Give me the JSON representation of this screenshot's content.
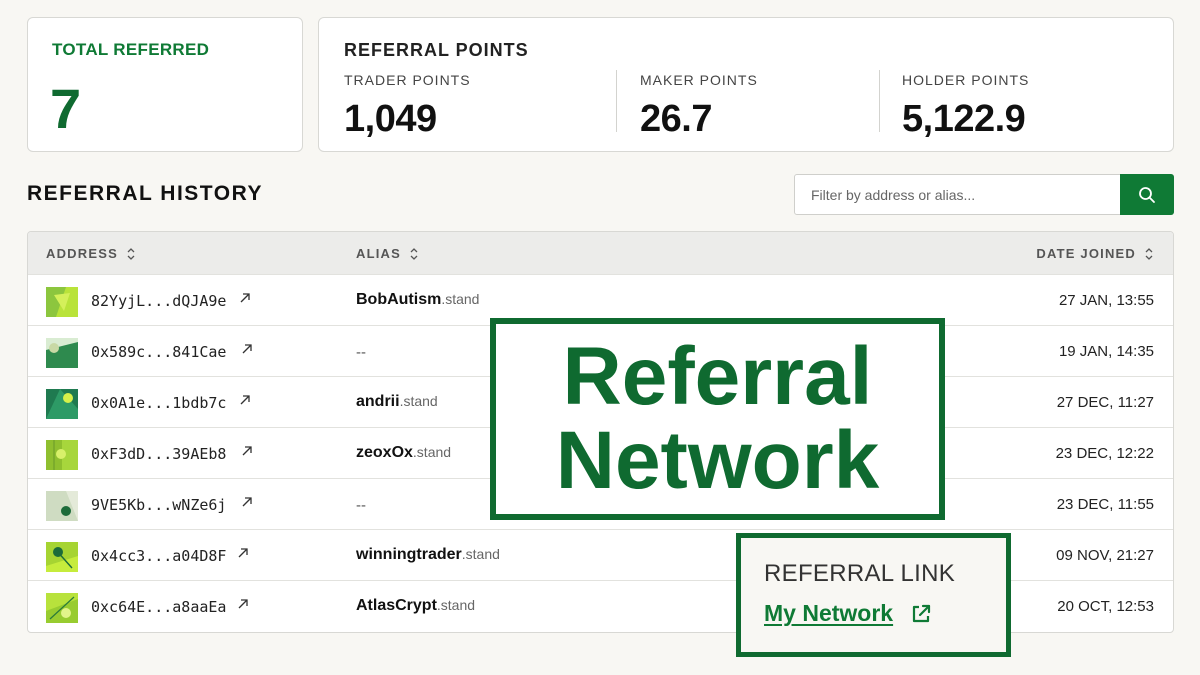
{
  "summary": {
    "total_label": "TOTAL REFERRED",
    "total_value": "7",
    "points_title": "REFERRAL POINTS",
    "points": [
      {
        "label": "TRADER POINTS",
        "value": "1,049"
      },
      {
        "label": "MAKER POINTS",
        "value": "26.7"
      },
      {
        "label": "HOLDER POINTS",
        "value": "5,122.9"
      }
    ]
  },
  "history": {
    "title": "REFERRAL HISTORY",
    "search_placeholder": "Filter by address or alias...",
    "columns": {
      "address": "ADDRESS",
      "alias": "ALIAS",
      "date": "DATE JOINED"
    },
    "rows": [
      {
        "address": "82YyjL...dQJA9e",
        "alias": "BobAutism",
        "suffix": ".stand",
        "date": "27 JAN, 13:55"
      },
      {
        "address": "0x589c...841Cae",
        "alias": "--",
        "suffix": "",
        "date": "19 JAN, 14:35"
      },
      {
        "address": "0x0A1e...1bdb7c",
        "alias": "andrii",
        "suffix": ".stand",
        "date": "27 DEC, 11:27"
      },
      {
        "address": "0xF3dD...39AEb8",
        "alias": "zeoxOx",
        "suffix": ".stand",
        "date": "23 DEC, 12:22"
      },
      {
        "address": "9VE5Kb...wNZe6j",
        "alias": "--",
        "suffix": "",
        "date": "23 DEC, 11:55"
      },
      {
        "address": "0x4cc3...a04D8F",
        "alias": "winningtrader",
        "suffix": ".stand",
        "date": "09 NOV, 21:27"
      },
      {
        "address": "0xc64E...a8aaEa",
        "alias": "AtlasCrypt",
        "suffix": ".stand",
        "date": "20 OCT, 12:53"
      }
    ]
  },
  "overlay": {
    "line1": "Referral",
    "line2": "Network",
    "link_title": "REFERRAL LINK",
    "link_text": "My Network"
  },
  "colors": {
    "accent": "#0f7a35",
    "accent_dark": "#0f6a30",
    "background": "#f8f7f3"
  }
}
